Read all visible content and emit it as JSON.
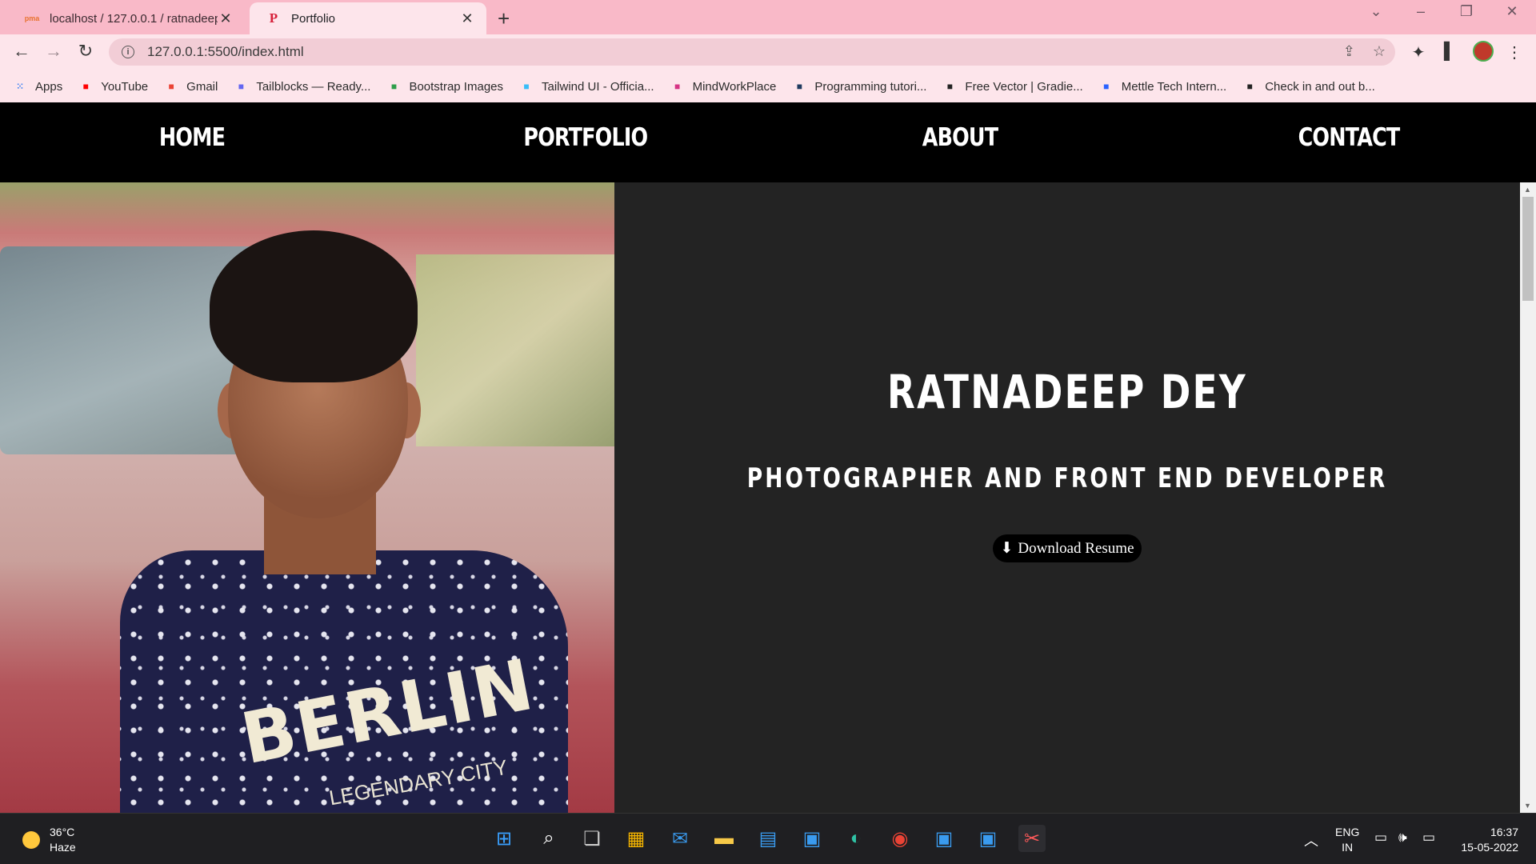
{
  "browser": {
    "tabs": [
      {
        "title": "localhost / 127.0.0.1 / ratnadeep",
        "favicon": "pma"
      },
      {
        "title": "Portfolio",
        "favicon": "P"
      }
    ],
    "url": "127.0.0.1:5500/index.html",
    "bookmarks": [
      {
        "label": "Apps",
        "icon": "apps-grid-icon",
        "color": "#4285f4"
      },
      {
        "label": "YouTube",
        "icon": "youtube-icon",
        "color": "#ff0000"
      },
      {
        "label": "Gmail",
        "icon": "gmail-icon",
        "color": "#ea4335"
      },
      {
        "label": "Tailblocks — Ready...",
        "icon": "tailblocks-icon",
        "color": "#6366f1"
      },
      {
        "label": "Bootstrap Images",
        "icon": "w3-icon",
        "color": "#2e9e4a"
      },
      {
        "label": "Tailwind UI - Officia...",
        "icon": "tailwind-icon",
        "color": "#38bdf8"
      },
      {
        "label": "MindWorkPlace",
        "icon": "mindworkplace-icon",
        "color": "#d63384"
      },
      {
        "label": "Programming tutori...",
        "icon": "hashnode-icon",
        "color": "#1e3a5f"
      },
      {
        "label": "Free Vector | Gradie...",
        "icon": "freepik-icon",
        "color": "#222222"
      },
      {
        "label": "Mettle Tech Intern...",
        "icon": "mettle-icon",
        "color": "#2962ff"
      },
      {
        "label": "Check in and out b...",
        "icon": "codepen-icon",
        "color": "#222222"
      }
    ]
  },
  "site": {
    "nav": [
      "HOME",
      "PORTFOLIO",
      "ABOUT",
      "CONTACT"
    ],
    "name": "RATNADEEP DEY",
    "tagline": "PHOTOGRAPHER AND FRONT END DEVELOPER",
    "resume_button": "Download Resume",
    "photo_text": {
      "shirt_print": "BERLIN",
      "shirt_sub": "LEGENDARY CITY"
    }
  },
  "taskbar": {
    "weather_temp": "36°C",
    "weather_desc": "Haze",
    "lang_top": "ENG",
    "lang_bottom": "IN",
    "time": "16:37",
    "date": "15-05-2022"
  }
}
